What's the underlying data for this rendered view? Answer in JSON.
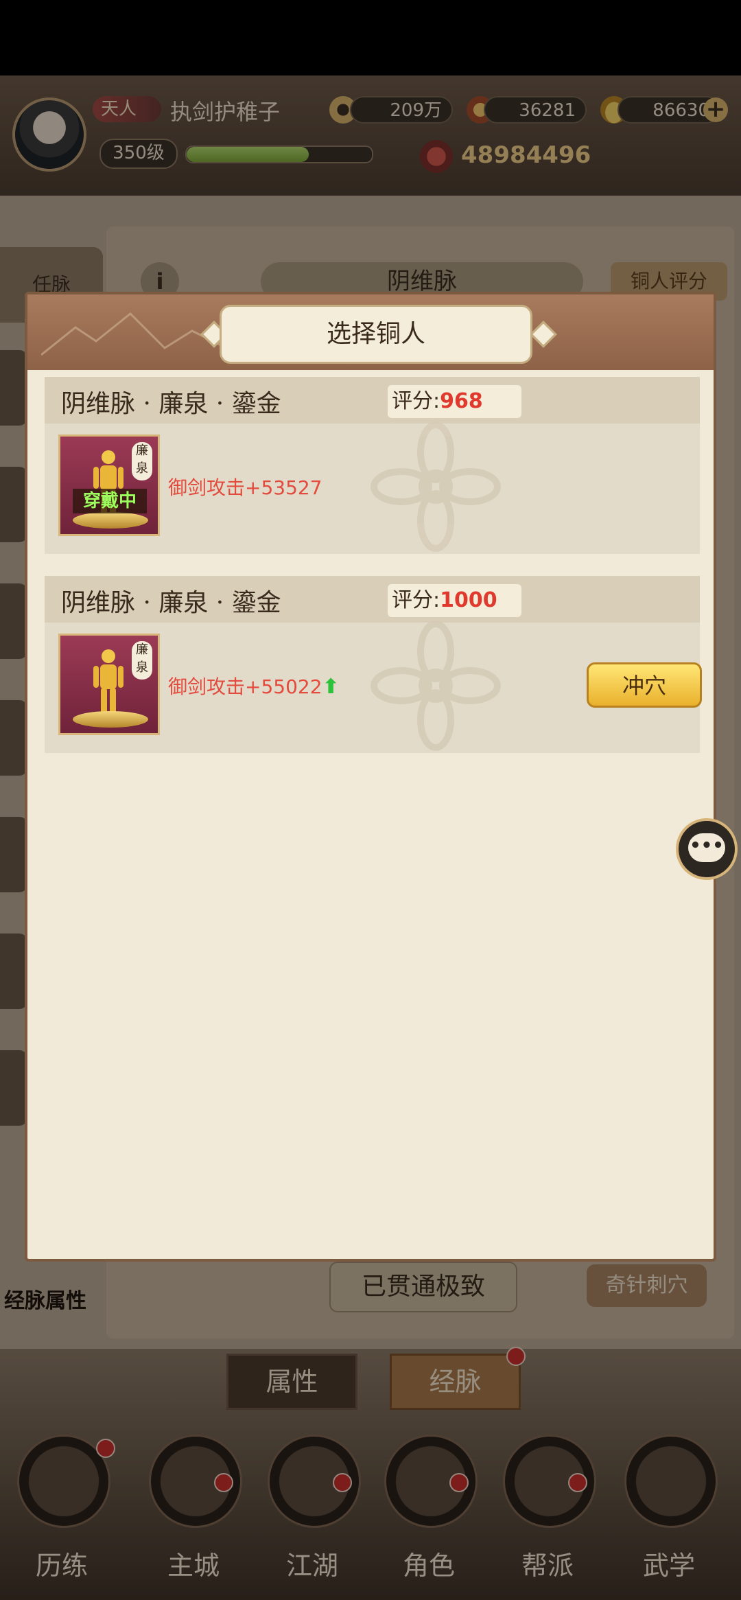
{
  "header": {
    "rank_badge": "天人",
    "player_name": "执剑护稚子",
    "level": "350级",
    "exp_fraction": 0.66,
    "coins": "209万",
    "gems": "36281",
    "gold": "86630",
    "power": "48984496"
  },
  "background": {
    "panel_title": "阴维脉",
    "score_button": "铜人评分",
    "info_icon": "i",
    "side_tab_ren": "任脉",
    "button_left": "已贯通极致",
    "button_right": "奇针刺穴",
    "attr_label": "经脉属性"
  },
  "modal": {
    "title": "选择铜人",
    "cards": [
      {
        "title": "阴维脉 · 廉泉 · 鎏金",
        "score_label": "评分:",
        "score_value": "968",
        "item_tag": "廉泉",
        "status": "穿戴中",
        "bonus": "御剑攻击+53527"
      },
      {
        "title": "阴维脉 · 廉泉 · 鎏金",
        "score_label": "评分:",
        "score_value": "1000",
        "item_tag": "廉泉",
        "bonus": "御剑攻击+55022",
        "action": "冲穴"
      }
    ]
  },
  "tabs": {
    "attributes": "属性",
    "meridians": "经脉"
  },
  "nav": [
    {
      "label": "历练"
    },
    {
      "label": "主城"
    },
    {
      "label": "江湖"
    },
    {
      "label": "角色"
    },
    {
      "label": "帮派"
    },
    {
      "label": "武学"
    }
  ],
  "chat": {
    "icon": "chat-bubble-icon",
    "glyph": "•••"
  },
  "colors": {
    "score_red": "#e03a2e",
    "bonus_red": "#e24b3e",
    "up_green": "#2ec23c",
    "button_gold": "#e9b12c"
  }
}
